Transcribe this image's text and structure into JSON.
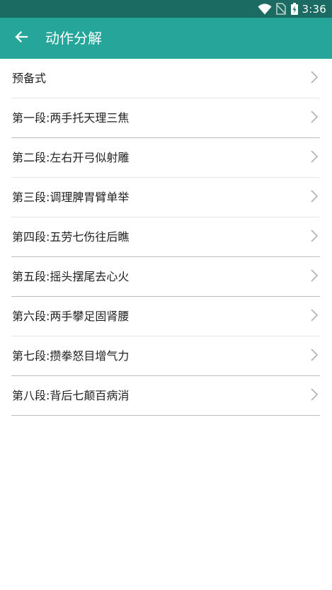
{
  "status_bar": {
    "time": "3:36",
    "icons": [
      "wifi-icon",
      "no-sim-icon",
      "battery-charging-icon"
    ]
  },
  "header": {
    "title": "动作分解",
    "back_icon": "arrow-left-icon"
  },
  "colors": {
    "status_bar": "#1b6b62",
    "app_bar": "#26a69a",
    "text": "#222222",
    "chevron": "#b0b0b0"
  },
  "list": {
    "chevron_icon": "chevron-right-icon",
    "items": [
      {
        "label": "预备式"
      },
      {
        "label": "第一段:两手托天理三焦"
      },
      {
        "label": "第二段:左右开弓似射雕"
      },
      {
        "label": "第三段:调理脾胃臂单举"
      },
      {
        "label": "第四段:五劳七伤往后瞧"
      },
      {
        "label": "第五段:摇头摆尾去心火"
      },
      {
        "label": "第六段:两手攀足固肾腰"
      },
      {
        "label": "第七段:攒拳怒目增气力"
      },
      {
        "label": "第八段:背后七颠百病消"
      }
    ]
  }
}
